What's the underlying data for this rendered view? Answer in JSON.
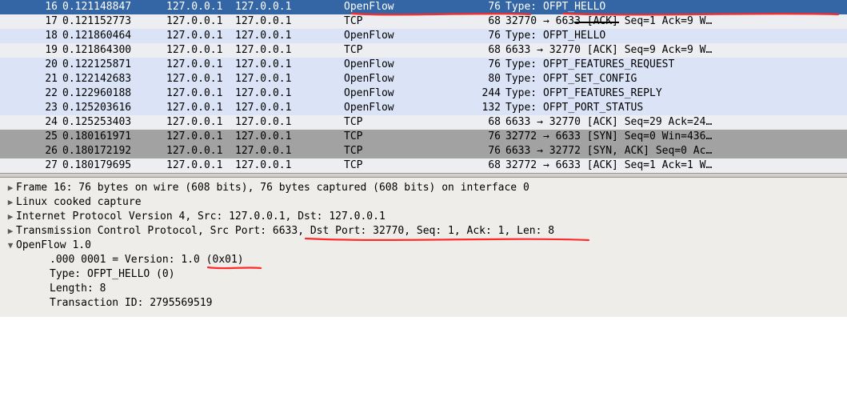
{
  "packets": [
    {
      "no": "16",
      "time": "0.121148847",
      "src": "127.0.0.1",
      "dst": "127.0.0.1",
      "proto": "OpenFlow",
      "len": "76",
      "info": "Type: OFPT_HELLO",
      "cls": "sel"
    },
    {
      "no": "17",
      "time": "0.121152773",
      "src": "127.0.0.1",
      "dst": "127.0.0.1",
      "proto": "TCP",
      "len": "68",
      "info": "32770 → 6633 [ACK] Seq=1 Ack=9 W…",
      "cls": "tcp"
    },
    {
      "no": "18",
      "time": "0.121860464",
      "src": "127.0.0.1",
      "dst": "127.0.0.1",
      "proto": "OpenFlow",
      "len": "76",
      "info": "Type: OFPT_HELLO",
      "cls": "of"
    },
    {
      "no": "19",
      "time": "0.121864300",
      "src": "127.0.0.1",
      "dst": "127.0.0.1",
      "proto": "TCP",
      "len": "68",
      "info": "6633 → 32770 [ACK] Seq=9 Ack=9 W…",
      "cls": "tcp"
    },
    {
      "no": "20",
      "time": "0.122125871",
      "src": "127.0.0.1",
      "dst": "127.0.0.1",
      "proto": "OpenFlow",
      "len": "76",
      "info": "Type: OFPT_FEATURES_REQUEST",
      "cls": "of"
    },
    {
      "no": "21",
      "time": "0.122142683",
      "src": "127.0.0.1",
      "dst": "127.0.0.1",
      "proto": "OpenFlow",
      "len": "80",
      "info": "Type: OFPT_SET_CONFIG",
      "cls": "of"
    },
    {
      "no": "22",
      "time": "0.122960188",
      "src": "127.0.0.1",
      "dst": "127.0.0.1",
      "proto": "OpenFlow",
      "len": "244",
      "info": "Type: OFPT_FEATURES_REPLY",
      "cls": "of"
    },
    {
      "no": "23",
      "time": "0.125203616",
      "src": "127.0.0.1",
      "dst": "127.0.0.1",
      "proto": "OpenFlow",
      "len": "132",
      "info": "Type: OFPT_PORT_STATUS",
      "cls": "of"
    },
    {
      "no": "24",
      "time": "0.125253403",
      "src": "127.0.0.1",
      "dst": "127.0.0.1",
      "proto": "TCP",
      "len": "68",
      "info": "6633 → 32770 [ACK] Seq=29 Ack=24…",
      "cls": "tcp"
    },
    {
      "no": "25",
      "time": "0.180161971",
      "src": "127.0.0.1",
      "dst": "127.0.0.1",
      "proto": "TCP",
      "len": "76",
      "info": "32772 → 6633 [SYN] Seq=0 Win=436…",
      "cls": "syn"
    },
    {
      "no": "26",
      "time": "0.180172192",
      "src": "127.0.0.1",
      "dst": "127.0.0.1",
      "proto": "TCP",
      "len": "76",
      "info": "6633 → 32772 [SYN, ACK] Seq=0 Ac…",
      "cls": "syn"
    },
    {
      "no": "27",
      "time": "0.180179695",
      "src": "127.0.0.1",
      "dst": "127.0.0.1",
      "proto": "TCP",
      "len": "68",
      "info": "32772 → 6633 [ACK] Seq=1 Ack=1 W…",
      "cls": "tcp"
    }
  ],
  "detail": {
    "frame": "Frame 16: 76 bytes on wire (608 bits), 76 bytes captured (608 bits) on interface 0",
    "linux": "Linux cooked capture",
    "ip": "Internet Protocol Version 4, Src: 127.0.0.1, Dst: 127.0.0.1",
    "tcp": "Transmission Control Protocol, Src Port: 6633, Dst Port: 32770, Seq: 1, Ack: 1, Len: 8",
    "ofhdr": "OpenFlow 1.0",
    "ver": ".000 0001 = Version: 1.0 (0x01)",
    "type": "Type: OFPT_HELLO (0)",
    "length": "Length: 8",
    "trans": "Transaction ID: 2795569519"
  },
  "glyphs": {
    "triRight": "▶",
    "triDown": "▼"
  }
}
